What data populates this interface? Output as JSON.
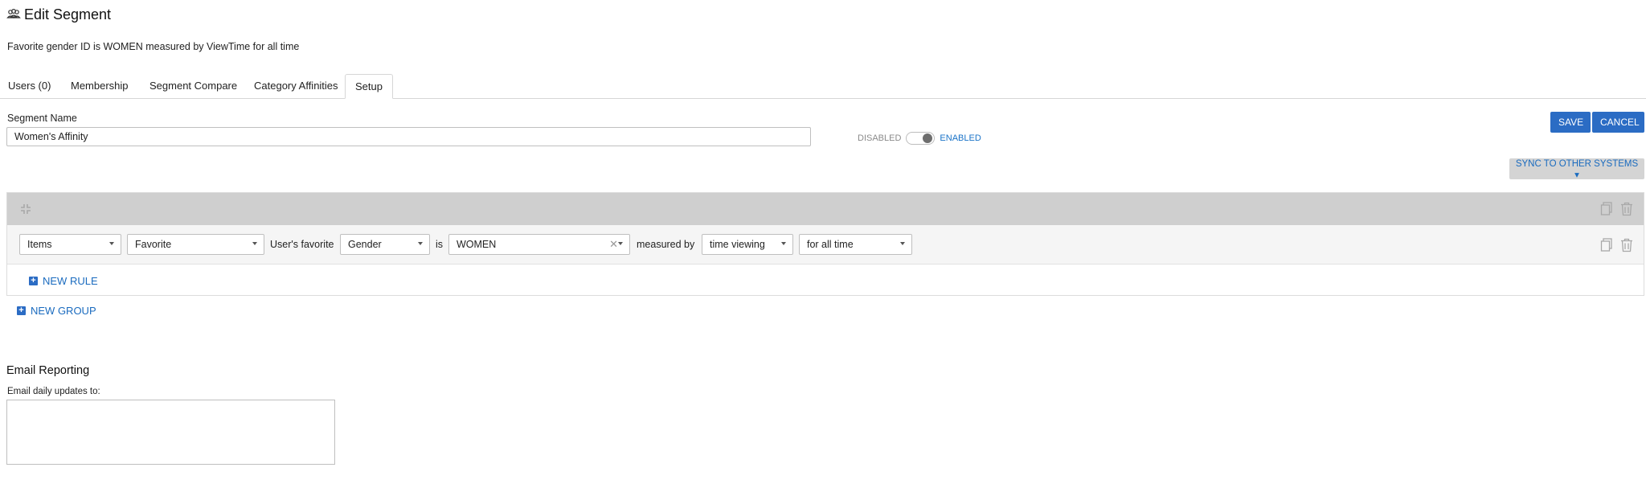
{
  "header": {
    "title": "Edit Segment",
    "subtitle": "Favorite gender ID is WOMEN measured by ViewTime for all time"
  },
  "tabs": [
    {
      "label": "Users (0)"
    },
    {
      "label": "Membership"
    },
    {
      "label": "Segment Compare"
    },
    {
      "label": "Category Affinities"
    },
    {
      "label": "Setup",
      "active": true
    }
  ],
  "segment": {
    "name_label": "Segment Name",
    "name_value": "Women's Affinity"
  },
  "status_toggle": {
    "off_label": "DISABLED",
    "on_label": "ENABLED",
    "state": "enabled"
  },
  "actions": {
    "save": "SAVE",
    "cancel": "CANCEL",
    "sync": "SYNC TO OTHER SYSTEMS ▾"
  },
  "rule": {
    "source": "Items",
    "mode": "Favorite",
    "text_users_favorite": "User's favorite",
    "attribute": "Gender",
    "text_is": "is",
    "value": "WOMEN",
    "text_measured_by": "measured by",
    "measure": "time viewing",
    "timeframe": "for all time"
  },
  "links": {
    "new_rule": "NEW RULE",
    "new_group": "NEW GROUP"
  },
  "email": {
    "title": "Email Reporting",
    "label": "Email daily updates to:",
    "value": ""
  },
  "colors": {
    "accent": "#2b6cc4",
    "link": "#1a6bbf",
    "group_header": "#cfcfcf"
  }
}
